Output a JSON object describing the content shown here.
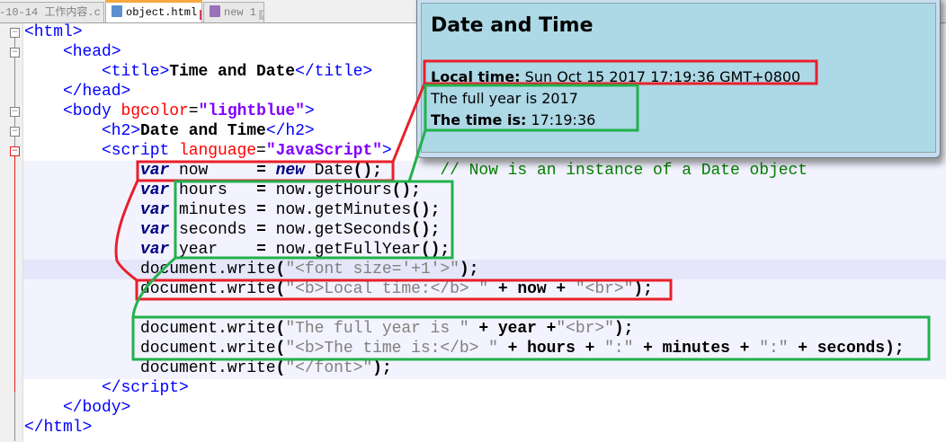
{
  "tabs": [
    {
      "label": "-10-14 工作内容.c",
      "active": false
    },
    {
      "label": "object.html",
      "active": true
    },
    {
      "label": "new 1",
      "active": false
    }
  ],
  "close_glyph": "✕",
  "code_lines": [
    [
      [
        "<html>",
        "tag"
      ]
    ],
    [
      [
        "    <head>",
        "tag"
      ]
    ],
    [
      [
        "        <title>",
        "tag"
      ],
      [
        "Time and Date",
        "txt"
      ],
      [
        "</title>",
        "tag"
      ]
    ],
    [
      [
        "    </head>",
        "tag"
      ]
    ],
    [
      [
        "    <body ",
        "tag"
      ],
      [
        "bgcolor",
        "attr"
      ],
      [
        "=",
        "pl"
      ],
      [
        "\"lightblue\"",
        "str"
      ],
      [
        ">",
        "tag"
      ]
    ],
    [
      [
        "        <h2>",
        "tag"
      ],
      [
        "Date and Time",
        "txt"
      ],
      [
        "</h2>",
        "tag"
      ]
    ],
    [
      [
        "        <script ",
        "tag"
      ],
      [
        "language",
        "attr"
      ],
      [
        "=",
        "pl"
      ],
      [
        "\"JavaScript\"",
        "str"
      ],
      [
        ">",
        "tag"
      ]
    ],
    [
      [
        "            ",
        "pl"
      ],
      [
        "var",
        "kw"
      ],
      [
        " now     ",
        "pl"
      ],
      [
        "=",
        "op"
      ],
      [
        " ",
        "pl"
      ],
      [
        "new",
        "kw"
      ],
      [
        " Date",
        "pl"
      ],
      [
        "();",
        "op"
      ],
      [
        "      ",
        "pl"
      ],
      [
        "// Now is an instance of a Date object",
        "cm"
      ]
    ],
    [
      [
        "            ",
        "pl"
      ],
      [
        "var",
        "kw"
      ],
      [
        " hours   ",
        "pl"
      ],
      [
        "=",
        "op"
      ],
      [
        " now.getHours",
        "pl"
      ],
      [
        "();",
        "op"
      ]
    ],
    [
      [
        "            ",
        "pl"
      ],
      [
        "var",
        "kw"
      ],
      [
        " minutes ",
        "pl"
      ],
      [
        "=",
        "op"
      ],
      [
        " now.getMinutes",
        "pl"
      ],
      [
        "();",
        "op"
      ]
    ],
    [
      [
        "            ",
        "pl"
      ],
      [
        "var",
        "kw"
      ],
      [
        " seconds ",
        "pl"
      ],
      [
        "=",
        "op"
      ],
      [
        " now.getSeconds",
        "pl"
      ],
      [
        "();",
        "op"
      ]
    ],
    [
      [
        "            ",
        "pl"
      ],
      [
        "var",
        "kw"
      ],
      [
        " year    ",
        "pl"
      ],
      [
        "=",
        "op"
      ],
      [
        " now.getFullYear",
        "pl"
      ],
      [
        "();",
        "op"
      ]
    ],
    [
      [
        "            document.write",
        "pl"
      ],
      [
        "(",
        "op"
      ],
      [
        "\"<font size='+1'>\"",
        "js"
      ],
      [
        ");",
        "op"
      ]
    ],
    [
      [
        "            document.write",
        "pl"
      ],
      [
        "(",
        "op"
      ],
      [
        "\"<b>Local time:</b> \"",
        "js"
      ],
      [
        " + now + ",
        "op"
      ],
      [
        "\"<br>\"",
        "js"
      ],
      [
        ");",
        "op"
      ]
    ],
    [
      [
        "",
        "pl"
      ]
    ],
    [
      [
        "            document.write",
        "pl"
      ],
      [
        "(",
        "op"
      ],
      [
        "\"The full year is \"",
        "js"
      ],
      [
        " + year +",
        "op"
      ],
      [
        "\"<br>\"",
        "js"
      ],
      [
        ");",
        "op"
      ]
    ],
    [
      [
        "            document.write",
        "pl"
      ],
      [
        "(",
        "op"
      ],
      [
        "\"<b>The time is:</b> \"",
        "js"
      ],
      [
        " + hours + ",
        "op"
      ],
      [
        "\":\"",
        "js"
      ],
      [
        " + minutes + ",
        "op"
      ],
      [
        "\":\"",
        "js"
      ],
      [
        " + seconds);",
        "op"
      ]
    ],
    [
      [
        "            document.write",
        "pl"
      ],
      [
        "(",
        "op"
      ],
      [
        "\"</font>\"",
        "js"
      ],
      [
        ");",
        "op"
      ]
    ],
    [
      [
        "        </script>",
        "tag"
      ]
    ],
    [
      [
        "    </body>",
        "tag"
      ]
    ],
    [
      [
        "</html>",
        "tag"
      ]
    ]
  ],
  "preview": {
    "heading": "Date and Time",
    "local_label": "Local time:",
    "local_value": " Sun Oct 15 2017 17:19:36 GMT+0800",
    "year_text": "The full year is 2017",
    "time_label": "The time is:",
    "time_value": " 17:19:36"
  },
  "colors": {
    "annot_red": "#e8202a",
    "annot_green": "#22b14c",
    "preview_bg": "#add8e6"
  }
}
